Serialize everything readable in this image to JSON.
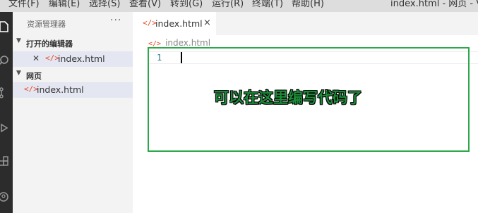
{
  "menubar": {
    "items": [
      "文件(F)",
      "编辑(E)",
      "选择(S)",
      "查看(V)",
      "转到(G)",
      "运行(R)",
      "终端(T)",
      "帮助(H)"
    ],
    "window_title": "index.html - 网页 - Visu"
  },
  "activity_bar": {
    "icons": [
      "files-icon",
      "search-icon",
      "source-control-icon",
      "run-debug-icon",
      "extensions-icon",
      "account-icon"
    ]
  },
  "sidebar": {
    "title": "资源管理器",
    "more": "···",
    "open_editors": {
      "label": "打开的编辑器",
      "files": [
        {
          "name": "index.html",
          "icon": "</>"
        }
      ]
    },
    "workspace": {
      "label": "网页",
      "files": [
        {
          "name": "index.html",
          "icon": "</>"
        }
      ]
    }
  },
  "editor": {
    "tab": {
      "name": "index.html",
      "icon": "</>",
      "close": "×"
    },
    "breadcrumb": "index.html",
    "line_number": "1",
    "annotation": "可以在这里编写代码了"
  },
  "colors": {
    "highlight_border": "#2aa84a",
    "annotation_text": "#1e8a3a",
    "html_icon": "#e44d26"
  }
}
